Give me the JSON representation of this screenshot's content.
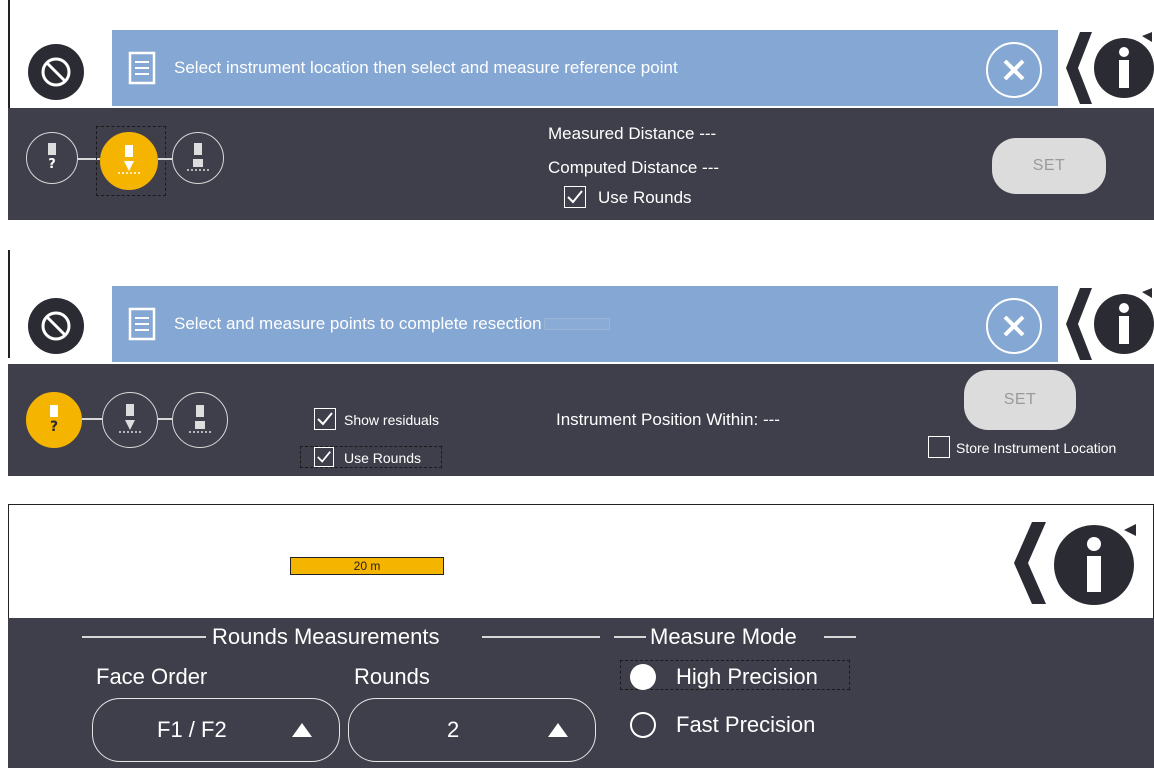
{
  "panel1": {
    "message": "Select instrument location then select and measure reference point",
    "measured_label": "Measured Distance",
    "measured_value": "---",
    "computed_label": "Computed Distance",
    "computed_value": "---",
    "use_rounds_label": "Use Rounds",
    "use_rounds_checked": true,
    "set_label": "SET"
  },
  "panel2": {
    "message": "Select and measure points to complete resection",
    "show_residuals_label": "Show residuals",
    "use_rounds_label": "Use Rounds",
    "position_label": "Instrument Position Within:",
    "position_value": "---",
    "set_label": "SET",
    "store_label": "Store Instrument Location"
  },
  "panel3": {
    "scale_label": "20 m",
    "rounds_section": "Rounds Measurements",
    "measure_mode_section": "Measure Mode",
    "face_order_label": "Face Order",
    "face_order_value": "F1 / F2",
    "rounds_label": "Rounds",
    "rounds_value": "2",
    "high_precision_label": "High Precision",
    "fast_precision_label": "Fast Precision",
    "selected_mode": "High Precision"
  },
  "colors": {
    "accent": "#f4b400",
    "message_bar": "#85a7d3",
    "panel": "#3f3f4b"
  },
  "icons": [
    "cancel-icon",
    "document-icon",
    "close-icon",
    "info-icon",
    "instrument-unknown-icon",
    "instrument-setup-icon",
    "instrument-measure-icon",
    "triangle-up-icon"
  ]
}
